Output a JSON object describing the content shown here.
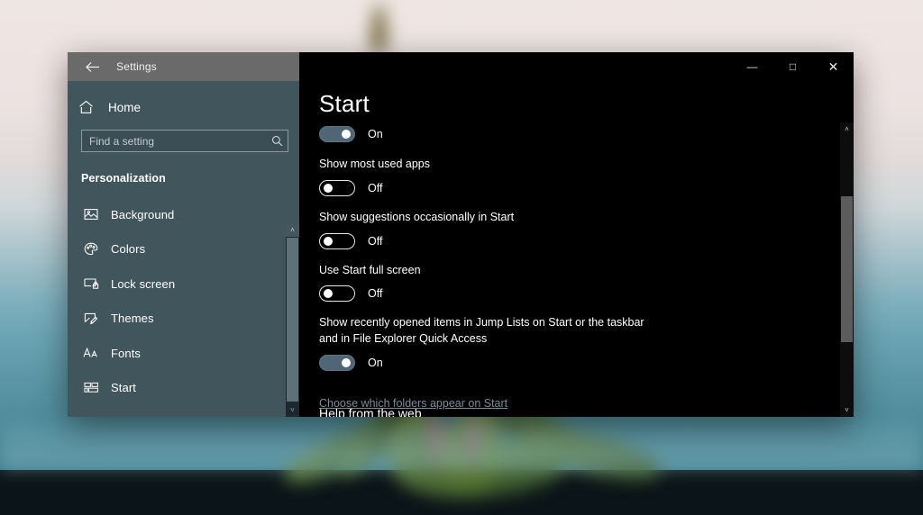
{
  "window": {
    "title": "Settings",
    "back_icon": "back-arrow-icon",
    "controls": {
      "minimize": "—",
      "maximize": "□",
      "close": "✕"
    }
  },
  "sidebar": {
    "home": {
      "label": "Home",
      "icon": "home-icon"
    },
    "search": {
      "placeholder": "Find a setting",
      "value": "",
      "icon": "search-icon"
    },
    "section_header": "Personalization",
    "items": [
      {
        "label": "Background",
        "icon": "image-icon"
      },
      {
        "label": "Colors",
        "icon": "palette-icon"
      },
      {
        "label": "Lock screen",
        "icon": "lock-screen-icon"
      },
      {
        "label": "Themes",
        "icon": "themes-brush-icon"
      },
      {
        "label": "Fonts",
        "icon": "fonts-aa-icon"
      },
      {
        "label": "Start",
        "icon": "start-tiles-icon"
      }
    ],
    "scrollbar": {
      "up": "˄",
      "down": "˅"
    }
  },
  "main": {
    "page_title": "Start",
    "settings": [
      {
        "label": "",
        "state": "On",
        "toggle": "on"
      },
      {
        "label": "Show most used apps",
        "state": "Off",
        "toggle": "off"
      },
      {
        "label": "Show suggestions occasionally in Start",
        "state": "Off",
        "toggle": "off"
      },
      {
        "label": "Use Start full screen",
        "state": "Off",
        "toggle": "off"
      },
      {
        "label": "Show recently opened items in Jump Lists on Start or the taskbar and in File Explorer Quick Access",
        "state": "On",
        "toggle": "on"
      }
    ],
    "link": "Choose which folders appear on Start",
    "clipped_heading": "Help from the web",
    "scrollbar": {
      "up": "˄",
      "down": "˅"
    }
  },
  "colors": {
    "sidebar_bg": "#41555c",
    "titlebar_bg": "#6a6a6a",
    "content_bg": "#000000",
    "toggle_on": "#4f6675",
    "link": "#7b8d99"
  }
}
